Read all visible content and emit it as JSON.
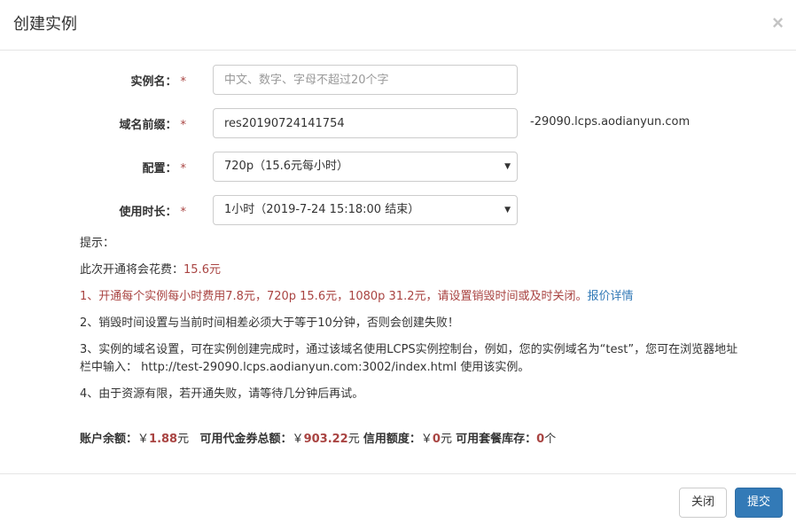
{
  "dialog": {
    "title": "创建实例",
    "close_glyph": "×"
  },
  "form": {
    "required_mark": "*",
    "name": {
      "label": "实例名：",
      "value": "",
      "placeholder": "中文、数字、字母不超过20个字"
    },
    "domain": {
      "label": "域名前缀：",
      "value": "res20190724141754",
      "suffix": "-29090.lcps.aodianyun.com"
    },
    "config": {
      "label": "配置：",
      "selected": "720p（15.6元每小时）"
    },
    "duration": {
      "label": "使用时长：",
      "selected": "1小时（2019-7-24 15:18:00 结束）"
    }
  },
  "tips": {
    "heading": "提示：",
    "cost_prefix": "此次开通将会花费：",
    "cost_value": "15.6元",
    "tip1": "1、开通每个实例每小时费用7.8元，720p 15.6元，1080p 31.2元，请设置销毁时间或及时关闭。",
    "tip1_link": "报价详情",
    "tip2": "2、销毁时间设置与当前时间相差必须大于等于10分钟，否则会创建失败！",
    "tip3_line1": "3、实例的域名设置，可在实例创建完成时，通过该域名使用LCPS实例控制台，例如，您的实例域名为“test”，您可在浏览器地址",
    "tip3_line2": "栏中输入： http://test-29090.lcps.aodianyun.com:3002/index.html 使用该实例。",
    "tip4": "4、由于资源有限，若开通失败，请等待几分钟后再试。"
  },
  "balance": {
    "account_label": "账户余额：",
    "currency": "￥",
    "account_value": "1.88",
    "yuan": "元",
    "voucher_label": "可用代金券总额：",
    "voucher_value": "903.22",
    "credit_label": "信用额度：",
    "credit_value": "0",
    "package_label": "可用套餐库存：",
    "package_value": "0",
    "package_unit": "个"
  },
  "footer": {
    "close_label": "关闭",
    "submit_label": "提交"
  },
  "colors": {
    "primary": "#337ab7",
    "danger": "#a94442",
    "link": "#337ab7"
  },
  "icons": {
    "close": "close-icon",
    "select_caret": "caret-down-icon"
  }
}
